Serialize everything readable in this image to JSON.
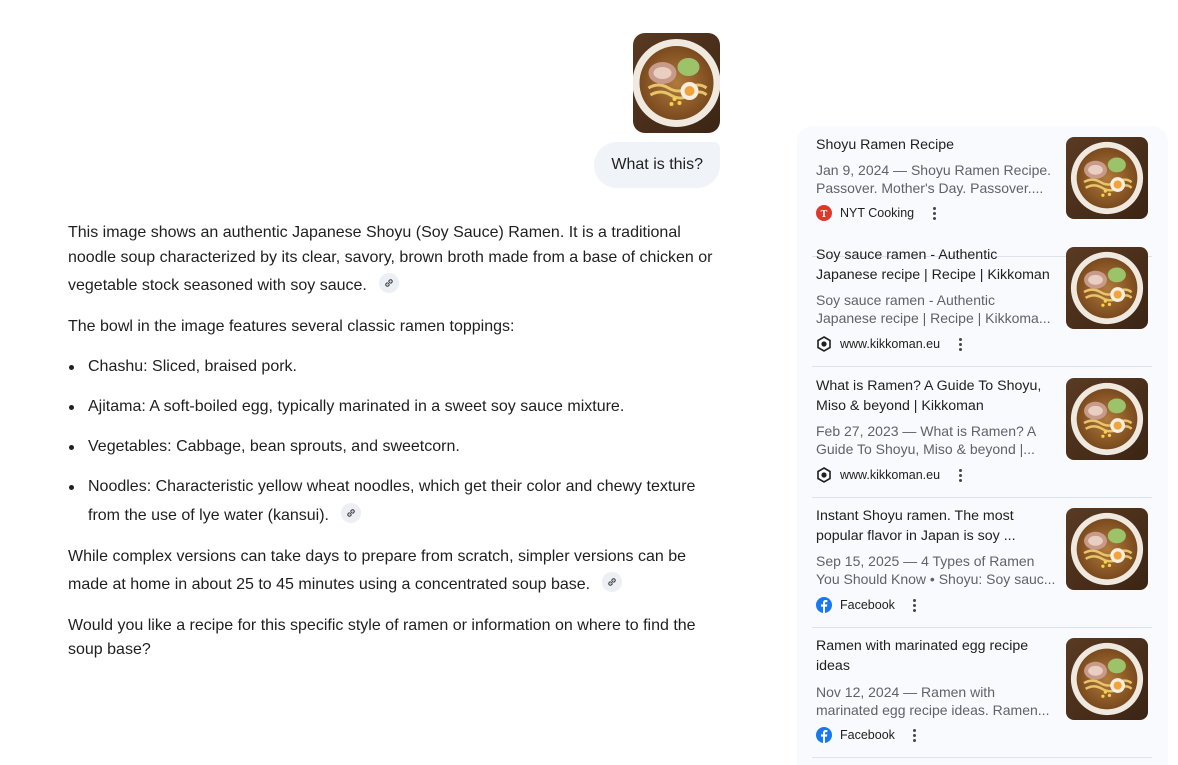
{
  "user": {
    "image_alt": "bowl of shoyu ramen",
    "question": "What is this?"
  },
  "answer": {
    "intro": "This image shows an authentic Japanese Shoyu (Soy Sauce) Ramen. It is a traditional noodle soup characterized by its clear, savory, brown broth made from a base of chicken or vegetable stock seasoned with soy sauce.",
    "toppings_intro": "The bowl in the image features several classic ramen toppings:",
    "toppings": [
      "Chashu: Sliced, braised pork.",
      "Ajitama: A soft-boiled egg, typically marinated in a sweet soy sauce mixture.",
      "Vegetables: Cabbage, bean sprouts, and sweetcorn.",
      "Noodles: Characteristic yellow wheat noodles, which get their color and chewy texture from the use of lye water (kansui)."
    ],
    "prep": "While complex versions can take days to prepare from scratch, simpler versions can be made at home in about 25 to 45 minutes using a concentrated soup base.",
    "followup": "Would you like a recipe for this specific style of ramen or information on where to find the soup base?"
  },
  "sources": [
    {
      "title": "Shoyu Ramen Recipe",
      "snippet_line1": "Jan 9, 2024 — Shoyu Ramen Recipe.",
      "snippet_line2": "Passover. Mother's Day. Passover....",
      "source": "NYT Cooking",
      "favicon": "nyt-cooking-icon",
      "favicon_color": "#e0362c"
    },
    {
      "title": "Soy sauce ramen - Authentic Japanese recipe | Recipe | Kikkoman",
      "snippet_line1": "Soy sauce ramen - Authentic",
      "snippet_line2": "Japanese recipe | Recipe | Kikkoma...",
      "source": "www.kikkoman.eu",
      "favicon": "kikkoman-icon",
      "favicon_color": "#1f1f1f"
    },
    {
      "title": "What is Ramen? A Guide To Shoyu, Miso & beyond | Kikkoman",
      "snippet_line1": "Feb 27, 2023 — What is Ramen? A",
      "snippet_line2": "Guide To Shoyu, Miso & beyond |...",
      "source": "www.kikkoman.eu",
      "favicon": "kikkoman-icon",
      "favicon_color": "#1f1f1f"
    },
    {
      "title": "Instant Shoyu ramen. The most popular flavor in Japan is soy ...",
      "snippet_line1": "Sep 15, 2025 — 4 Types of Ramen",
      "snippet_line2": "You Should Know • Shoyu: Soy sauc...",
      "source": "Facebook",
      "favicon": "facebook-icon",
      "favicon_color": "#1877f2"
    },
    {
      "title": "Ramen with marinated egg recipe ideas",
      "snippet_line1": "Nov 12, 2024 — Ramen with",
      "snippet_line2": "marinated egg recipe ideas. Ramen...",
      "source": "Facebook",
      "favicon": "facebook-icon",
      "favicon_color": "#1877f2"
    }
  ],
  "colors": {
    "user_bubble": "#f0f4f9",
    "panel_background": "#f8fafd",
    "snippet_text": "#5f6368"
  }
}
